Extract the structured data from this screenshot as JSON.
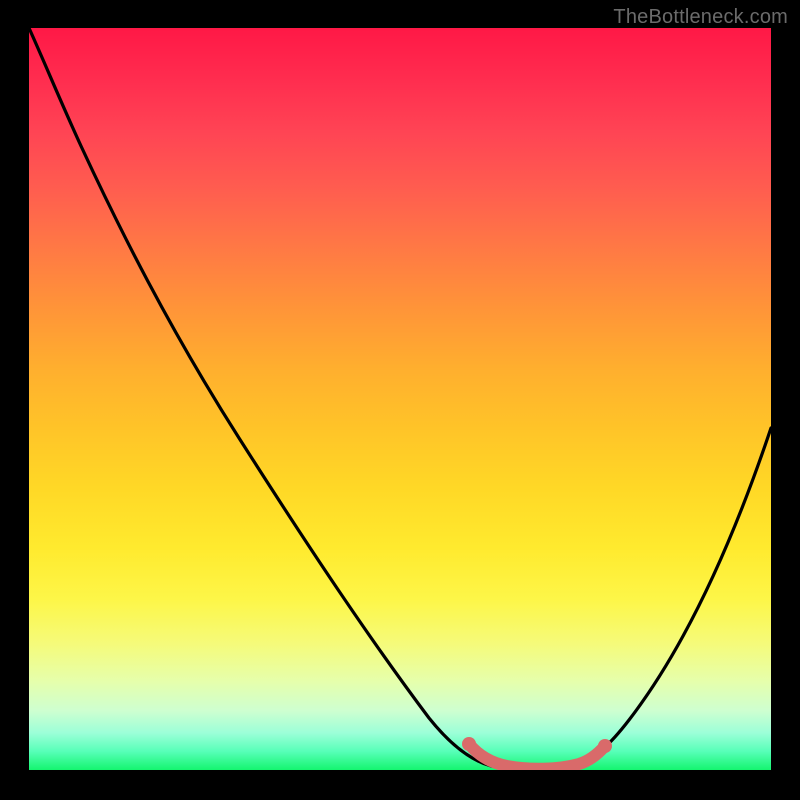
{
  "attribution": "TheBottleneck.com",
  "chart_data": {
    "type": "line",
    "title": "",
    "xlabel": "",
    "ylabel": "",
    "xlim": [
      0,
      1
    ],
    "ylim": [
      0,
      1
    ],
    "series": [
      {
        "name": "bottleneck-curve",
        "x": [
          0.0,
          0.04,
          0.1,
          0.18,
          0.26,
          0.34,
          0.42,
          0.5,
          0.56,
          0.6,
          0.64,
          0.68,
          0.72,
          0.76,
          0.8,
          0.86,
          0.92,
          1.0
        ],
        "y": [
          1.0,
          0.94,
          0.84,
          0.71,
          0.58,
          0.45,
          0.32,
          0.19,
          0.1,
          0.05,
          0.02,
          0.005,
          0.005,
          0.02,
          0.06,
          0.15,
          0.27,
          0.46
        ]
      },
      {
        "name": "sweet-spot-highlight",
        "x": [
          0.6,
          0.64,
          0.68,
          0.72,
          0.76
        ],
        "y": [
          0.05,
          0.02,
          0.005,
          0.005,
          0.02
        ]
      }
    ],
    "gradient_stops": [
      {
        "pos": 0.0,
        "color": "#ff1846"
      },
      {
        "pos": 0.5,
        "color": "#ffc428"
      },
      {
        "pos": 0.85,
        "color": "#f5fb7a"
      },
      {
        "pos": 1.0,
        "color": "#14f56f"
      }
    ]
  }
}
